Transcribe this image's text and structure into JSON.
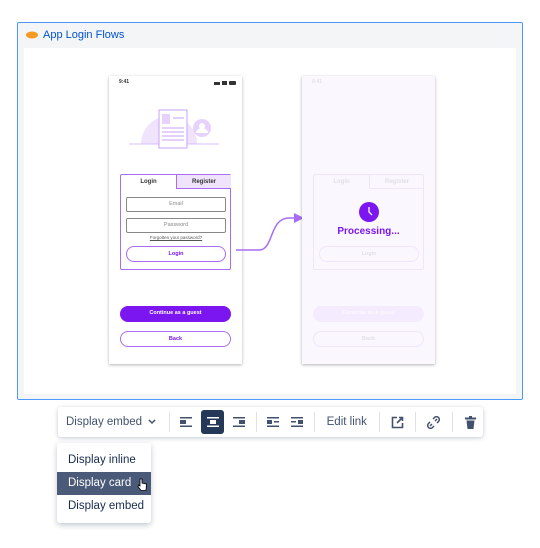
{
  "embed": {
    "title": "App Login Flows",
    "icon": "app-logo-icon"
  },
  "phone_left": {
    "time": "9:41",
    "tab_login": "Login",
    "tab_register": "Register",
    "email_placeholder": "Email",
    "password_placeholder": "Password",
    "forgot": "Forgotten your password?",
    "login_button": "Login",
    "guest_button": "Continue as a guest",
    "back_button": "Back"
  },
  "phone_right": {
    "time": "9:41",
    "tab_login": "Login",
    "tab_register": "Register",
    "processing": "Processing...",
    "login_button": "Login",
    "guest_button": "Continue as a guest",
    "back_button": "Back"
  },
  "colors": {
    "accent": "#7b16f0",
    "light": "#a86cf5",
    "frame_border": "#4c9aff",
    "selected": "#253858"
  },
  "toolbar": {
    "display_select": "Display embed",
    "edit_link": "Edit link",
    "active_alignment": "center"
  },
  "menu": {
    "items": [
      "Display inline",
      "Display card",
      "Display embed"
    ],
    "highlighted": "Display card"
  }
}
